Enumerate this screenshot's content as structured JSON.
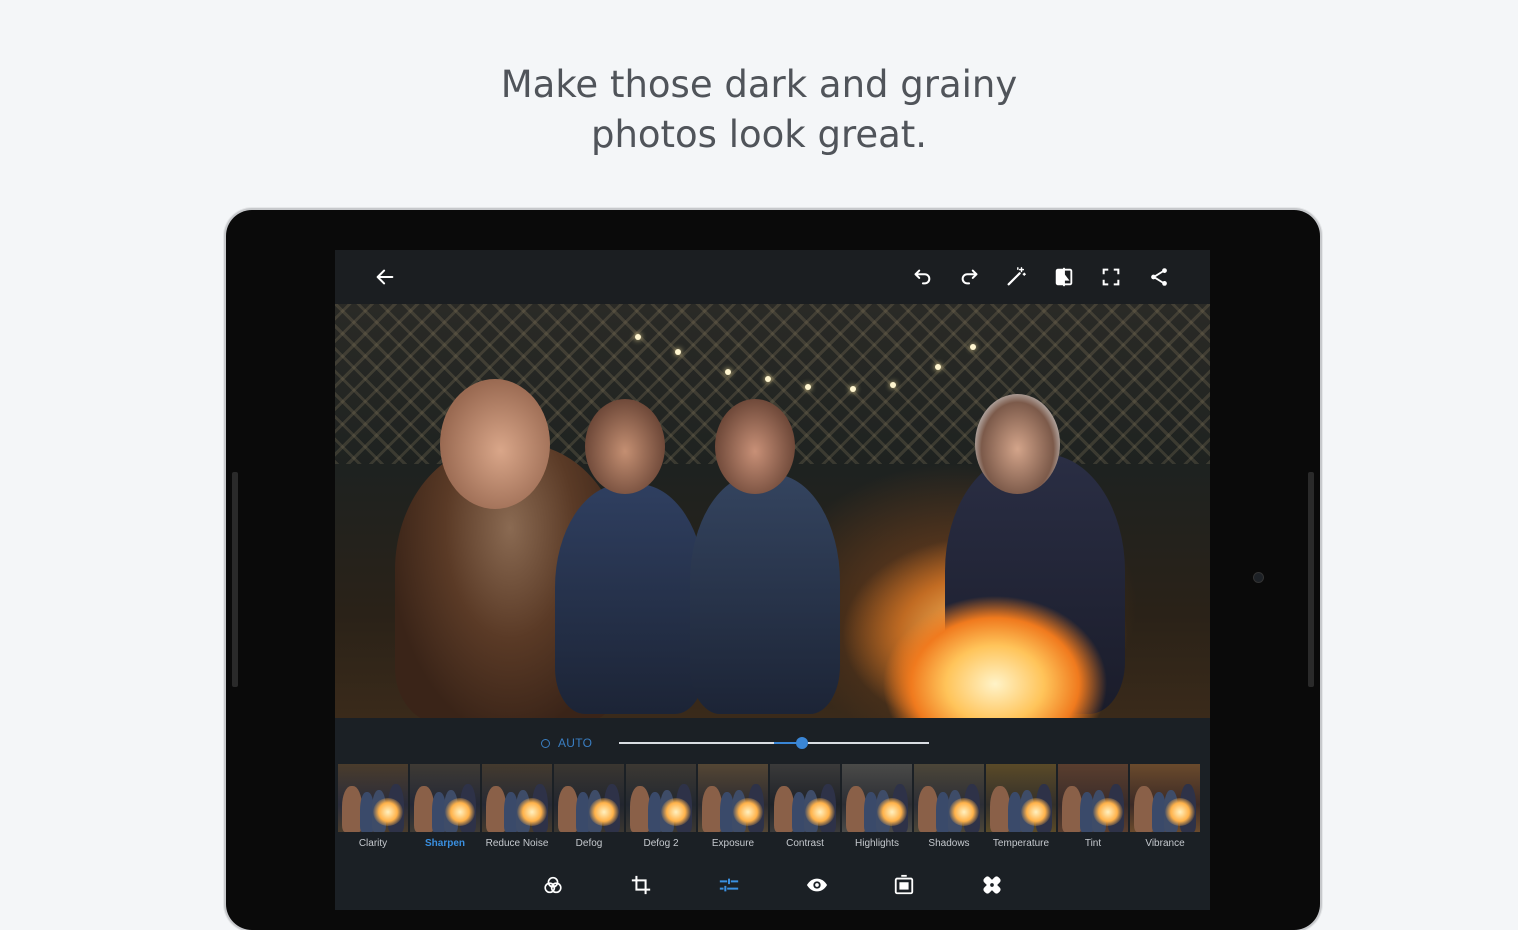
{
  "headline": {
    "line1": "Make those dark and grainy",
    "line2": "photos look great."
  },
  "toolbar": {
    "icons": [
      "back-arrow-icon",
      "undo-icon",
      "redo-icon",
      "magic-wand-icon",
      "compare-icon",
      "fullscreen-icon",
      "share-icon"
    ]
  },
  "adjust": {
    "auto_label": "AUTO",
    "slider_value": 0.59,
    "accent_color": "#3a86d6"
  },
  "presets": [
    {
      "label": "Clarity",
      "active": false
    },
    {
      "label": "Sharpen",
      "active": true
    },
    {
      "label": "Reduce Noise",
      "active": false
    },
    {
      "label": "Defog",
      "active": false
    },
    {
      "label": "Defog 2",
      "active": false
    },
    {
      "label": "Exposure",
      "active": false
    },
    {
      "label": "Contrast",
      "active": false
    },
    {
      "label": "Highlights",
      "active": false
    },
    {
      "label": "Shadows",
      "active": false
    },
    {
      "label": "Temperature",
      "active": false
    },
    {
      "label": "Tint",
      "active": false
    },
    {
      "label": "Vibrance",
      "active": false
    }
  ],
  "bottom_tools": [
    "looks-icon",
    "crop-icon",
    "adjustments-icon",
    "red-eye-icon",
    "frame-icon",
    "healing-icon"
  ],
  "colors": {
    "background": "#f4f6f8",
    "screen": "#1b1e21",
    "active_tab": "#3a8fe0"
  }
}
